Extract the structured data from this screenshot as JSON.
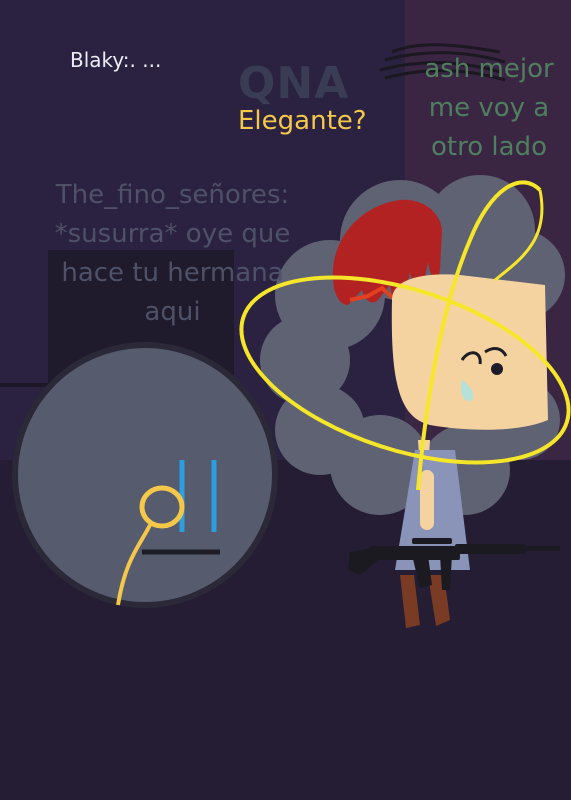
{
  "captions": {
    "blaky": "Blaky:. ...",
    "qna": "QNA",
    "elegante": "Elegante?",
    "fino": "The_fino_señores: *susurra* oye que hace tu hermana aqui",
    "ash": "ash mejor me voy a otro lado"
  },
  "colors": {
    "background": "#241d34",
    "text_light": "#ececf4",
    "accent_yellow": "#f4c84a",
    "caption_gray": "#4e5168",
    "caption_green": "#4f7f5f",
    "hair_gray": "#5e6272",
    "hat_red": "#b32222",
    "skin": "#f5d3a0",
    "dress": "#8a93b8",
    "scribble_yellow": "#f6e62a",
    "character_blue": "#2f9ee0"
  }
}
